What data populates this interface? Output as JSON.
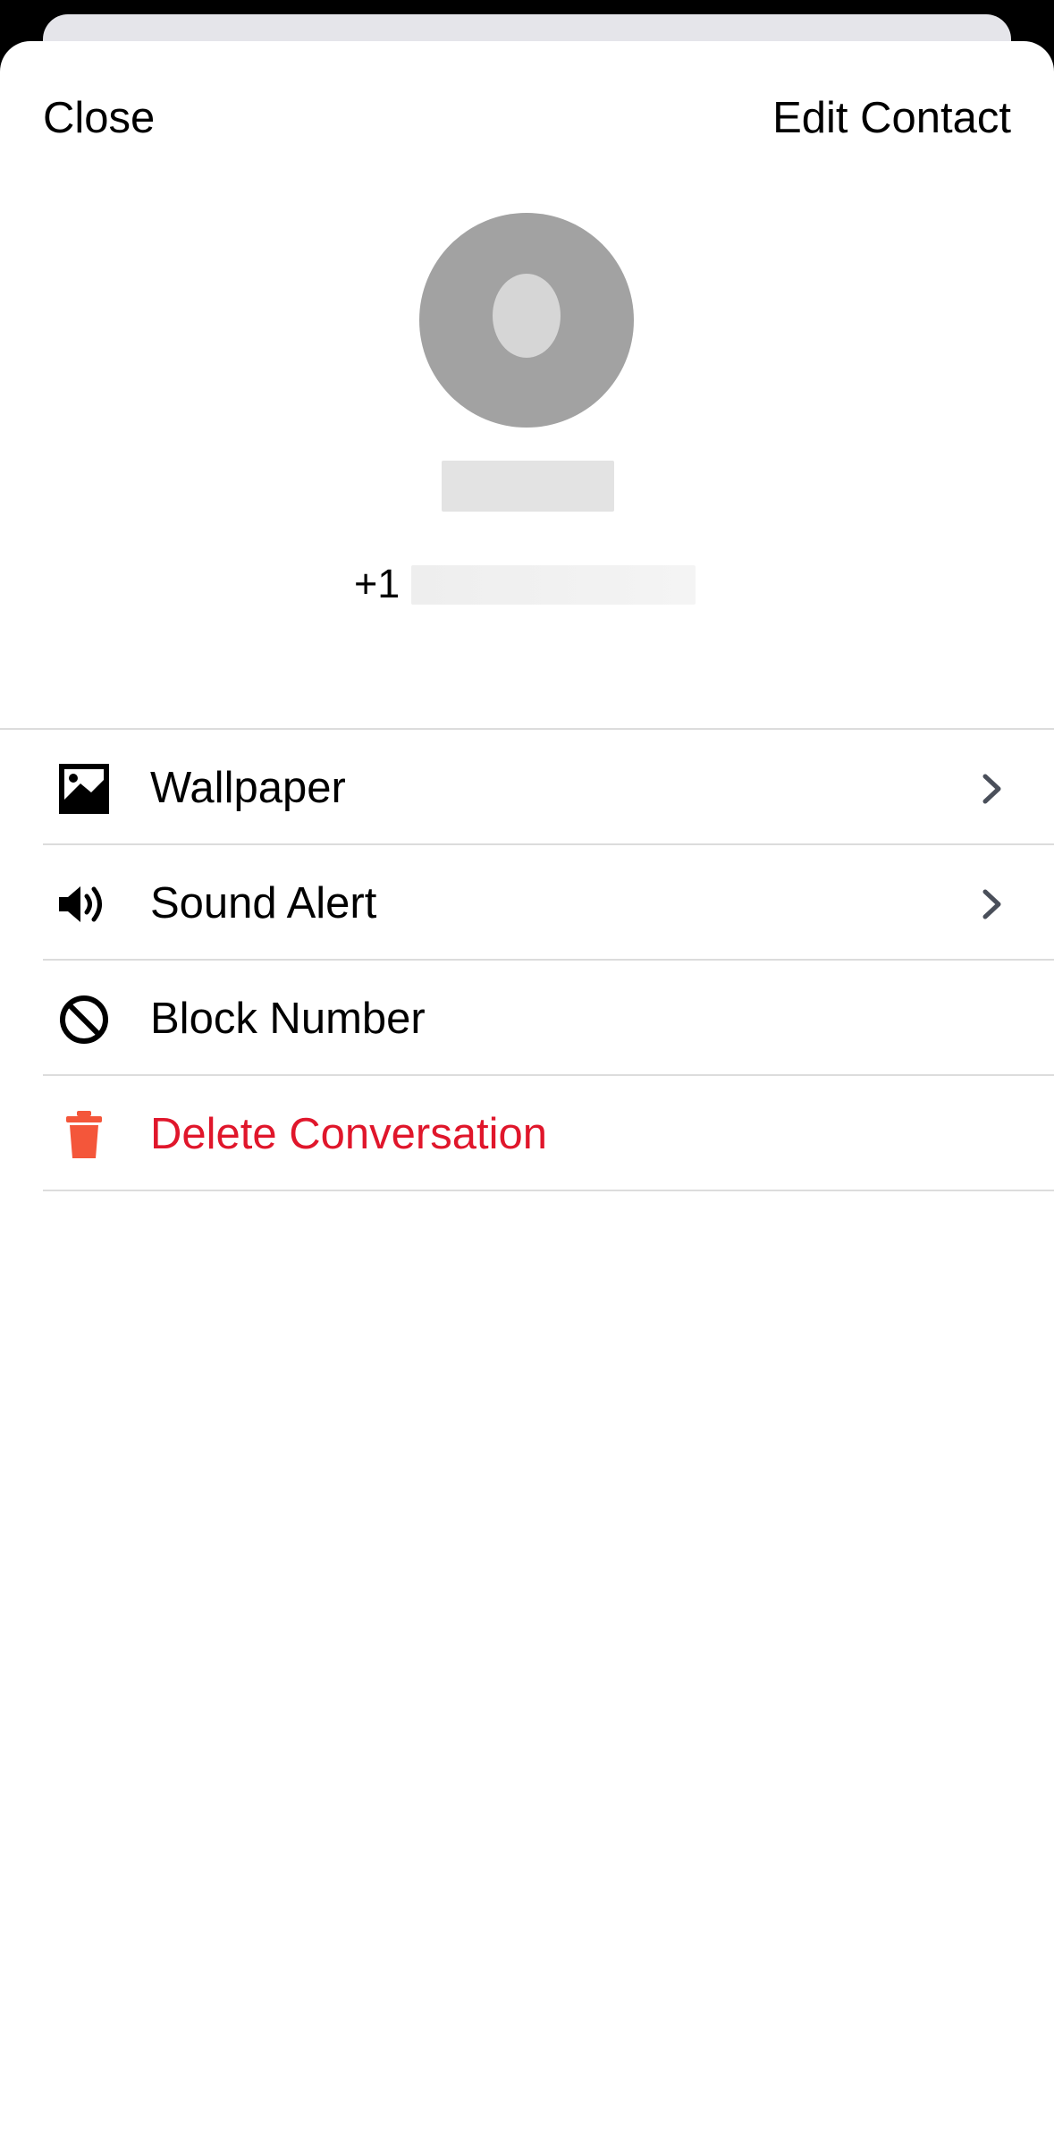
{
  "header": {
    "close_label": "Close",
    "edit_label": "Edit Contact"
  },
  "contact": {
    "phone_prefix": "+1",
    "name_redacted": true,
    "phone_redacted": true
  },
  "menu": {
    "items": [
      {
        "label": "Wallpaper",
        "icon": "image-icon",
        "has_chevron": true
      },
      {
        "label": "Sound Alert",
        "icon": "speaker-icon",
        "has_chevron": true
      },
      {
        "label": "Block Number",
        "icon": "block-icon",
        "has_chevron": false
      },
      {
        "label": "Delete Conversation",
        "icon": "trash-icon",
        "has_chevron": false,
        "destructive": true
      }
    ]
  },
  "colors": {
    "destructive_text": "#e0162b",
    "trash_icon": "#f4563a",
    "chevron": "#4a4f5a",
    "avatar_bg": "#a2a2a2"
  }
}
